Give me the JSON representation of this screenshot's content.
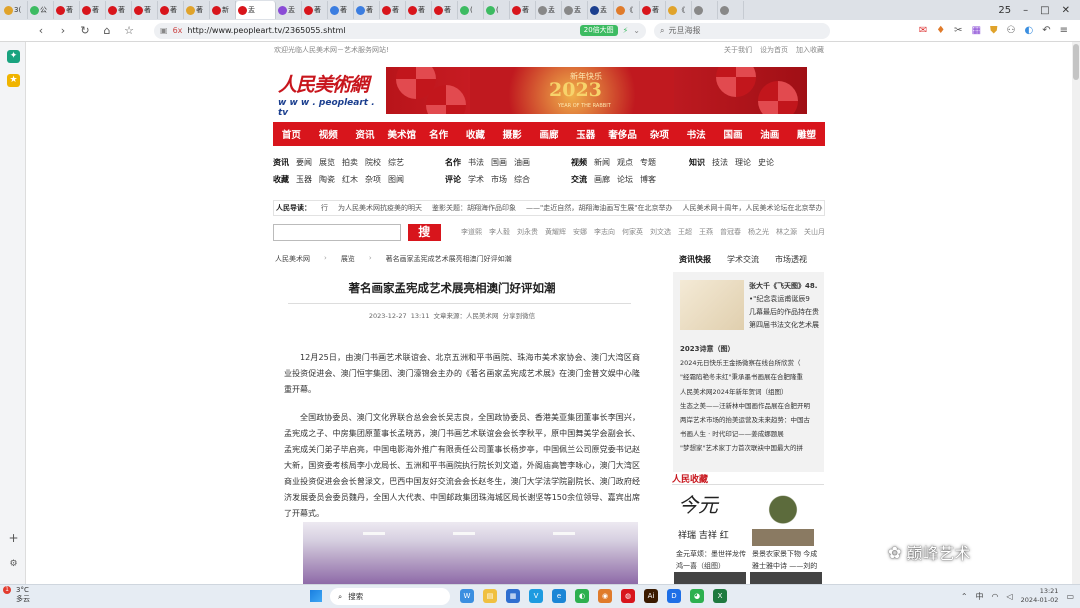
{
  "browser": {
    "tabs": [
      {
        "label": "3(",
        "color": "#e0a32b"
      },
      {
        "label": "公",
        "color": "#3dbb62"
      },
      {
        "label": "著",
        "color": "#d8151c"
      },
      {
        "label": "著",
        "color": "#d8151c"
      },
      {
        "label": "著",
        "color": "#d8151c"
      },
      {
        "label": "著",
        "color": "#d8151c"
      },
      {
        "label": "著",
        "color": "#d8151c"
      },
      {
        "label": "著",
        "color": "#e0a32b"
      },
      {
        "label": "新",
        "color": "#d8151c"
      },
      {
        "label": "盂",
        "color": "#d8151c",
        "active": true
      },
      {
        "label": "盂",
        "color": "#8a4bd6"
      },
      {
        "label": "著",
        "color": "#d8151c"
      },
      {
        "label": "著",
        "color": "#3b7de0"
      },
      {
        "label": "著",
        "color": "#3b7de0"
      },
      {
        "label": "著",
        "color": "#d8151c"
      },
      {
        "label": "著",
        "color": "#d8151c"
      },
      {
        "label": "著",
        "color": "#d8151c"
      },
      {
        "label": "(",
        "color": "#3dbb62"
      },
      {
        "label": "(",
        "color": "#3dbb62"
      },
      {
        "label": "著",
        "color": "#d8151c"
      },
      {
        "label": "孟",
        "color": "#888888"
      },
      {
        "label": "盂",
        "color": "#888888"
      },
      {
        "label": "孟",
        "color": "#1b3f8f"
      },
      {
        "label": "《",
        "color": "#e07b2b"
      },
      {
        "label": "著",
        "color": "#d8151c"
      },
      {
        "label": "《",
        "color": "#e0a32b"
      },
      {
        "label": "",
        "color": "#888888"
      },
      {
        "label": "",
        "color": "#888888"
      }
    ],
    "tab_count_badge": "25",
    "url": "http://www.peopleart.tv/2365055.shtml",
    "url_prefix": "6x",
    "speed_badge": "20倍大图",
    "search_placeholder": "元旦海报"
  },
  "site": {
    "welcome": "欢迎光临人民美术网－艺术服务网站!",
    "top_links": [
      "关于我们",
      "设为首页",
      "加入收藏"
    ],
    "logo_cn": "人民美術網",
    "logo_en": "w w w . peopleart . tv",
    "banner": {
      "greeting": "新年快乐",
      "year": "2023",
      "sub": "YEAR OF THE RABBIT"
    },
    "main_nav": [
      "首页",
      "视频",
      "资讯",
      "美术馆",
      "名作",
      "收藏",
      "摄影",
      "画廊",
      "玉器",
      "奢侈品",
      "杂项",
      "书法",
      "国画",
      "油画",
      "雕塑"
    ],
    "sub_nav": {
      "g1r1": {
        "head": "资讯",
        "items": [
          "要闻",
          "展览",
          "拍卖",
          "院校",
          "综艺"
        ]
      },
      "g1r2": {
        "head": "收藏",
        "items": [
          "玉器",
          "陶瓷",
          "红木",
          "杂项",
          "图闻"
        ]
      },
      "g2r1": {
        "head": "名作",
        "items": [
          "书法",
          "国画",
          "油画"
        ]
      },
      "g2r2": {
        "head": "评论",
        "items": [
          "学术",
          "市场",
          "综合"
        ]
      },
      "g3r1": {
        "head": "视频",
        "items": [
          "新闻",
          "观点",
          "专题"
        ]
      },
      "g3r2": {
        "head": "交流",
        "items": [
          "画廊",
          "论坛",
          "博客"
        ]
      },
      "g4r1": {
        "head": "知识",
        "items": [
          "技法",
          "理论",
          "史论"
        ]
      }
    },
    "ticker": {
      "label": "人民导读：",
      "items": [
        "行",
        "为人民美术网抗疫美的明天",
        "鉴影关题：胡翔海作品印象",
        "——\"走近自然，胡翔海油画写生展\"在北京举办",
        "人民美术网十周年，人民美术论坛在北京举办"
      ]
    },
    "search_button": "搜",
    "hot_keywords": [
      "李道熙",
      "李人毅",
      "刘永贵",
      "黄耀辉",
      "安娜",
      "李志向",
      "何家英",
      "刘文选",
      "王超",
      "王燕",
      "曾冠春",
      "杨之光",
      "林之源",
      "关山月"
    ]
  },
  "article": {
    "breadcrumb": [
      "人民美术网",
      "展览",
      "著名画家孟宪成艺术展亮相澳门好评如潮"
    ],
    "title": "著名画家孟宪成艺术展亮相澳门好评如潮",
    "date": "2023-12-27 13:11",
    "source": "文章来源：人民美术网",
    "share": "分享到微信",
    "p1": "12月25日，由澳门书画艺术联谊会、北京五洲和平书画院、珠海市美术家协会、澳门大湾区商业投资促进会、澳门恒宇集团、澳门濠锦会主办的《著名画家孟宪成艺术展》在澳门金普文娱中心隆重开幕。",
    "p2": "全国政协委员、澳门文化界联合总会会长吴志良，全国政协委员、香港美亚集团董事长李国兴，孟宪成之子、中房集团原董事长孟晓苏，澳门书画艺术联谊会会长李秋平，原中国舞美学会副会长、孟宪成关门弟子毕启亮，中国电影海外推广有限责任公司董事长杨步亭，中国佩兰公司原党委书记赵大新，国资委考核局李小龙局长、五洲和平书画院执行院长刘文道，外阁庙高管李咏心，澳门大湾区商业投资促进会会长曾渌文，巴西中国友好交流会会长赵冬生，澳门大学法学院副院长、澳门政府经济发展委员会委员魏丹，全国人大代表、中国邮政集团珠海城区局长谢坚等150余位领导、嘉宾出席了开幕式。"
  },
  "right": {
    "tabs": [
      "资讯快报",
      "学术交流",
      "市场透视"
    ],
    "feature_title": "张大千《飞天图》48.",
    "feature_lines": [
      "•\"纪念袁运甫诞辰9",
      "几幕最后的作品持在贵",
      "第四届书法文化艺术展"
    ],
    "list": [
      {
        "text": "2023诗意（图）",
        "bold": true
      },
      {
        "text": "2024元日快乐王金扬微察在线台所欣赏（",
        "bold": false
      },
      {
        "text": "\"经霜陷艳冬未红\"秉承墨书画展在合肥隆重",
        "bold": false
      },
      {
        "text": "人民美术网2024年新年贺词（组图）",
        "bold": false
      },
      {
        "text": "生态之美——汪新林中国画作品展在合肥开明",
        "bold": false
      },
      {
        "text": "两岸艺术市场的抬美运营及未来趋势：中国古",
        "bold": false
      },
      {
        "text": "书画人生 · 时代印记——姜成娜题展",
        "bold": false
      },
      {
        "text": "\"梦想家\"艺术家丁力首次联袂中国最大的拼",
        "bold": false
      }
    ],
    "collect_title": "人民收藏",
    "cap1": "金元草烦：墨世祥龙传鸿一喜（组图）",
    "cap2": "景景农家景下物 今成雅士雅中诗 ——刘的"
  },
  "watermark": "巅峰艺术",
  "taskbar": {
    "weather_temp": "3°C",
    "weather_desc": "多云",
    "notif": "1",
    "search_label": "搜索",
    "time": "13:21",
    "date": "2024-01-02",
    "lang": "中",
    "apps": [
      {
        "label": "W",
        "color": "#3b8fe0"
      },
      {
        "label": "▤",
        "color": "#f0c040"
      },
      {
        "label": "▦",
        "color": "#2f6fd0"
      },
      {
        "label": "V",
        "color": "#1d9be0"
      },
      {
        "label": "e",
        "color": "#1b86d6"
      },
      {
        "label": "◐",
        "color": "#2db04f"
      },
      {
        "label": "◉",
        "color": "#e07b2b"
      },
      {
        "label": "◍",
        "color": "#d8151c"
      },
      {
        "label": "Ai",
        "color": "#3a1a00"
      },
      {
        "label": "D",
        "color": "#1e6fe6"
      },
      {
        "label": "◕",
        "color": "#2db04f"
      },
      {
        "label": "X",
        "color": "#1f7a3f"
      }
    ]
  }
}
